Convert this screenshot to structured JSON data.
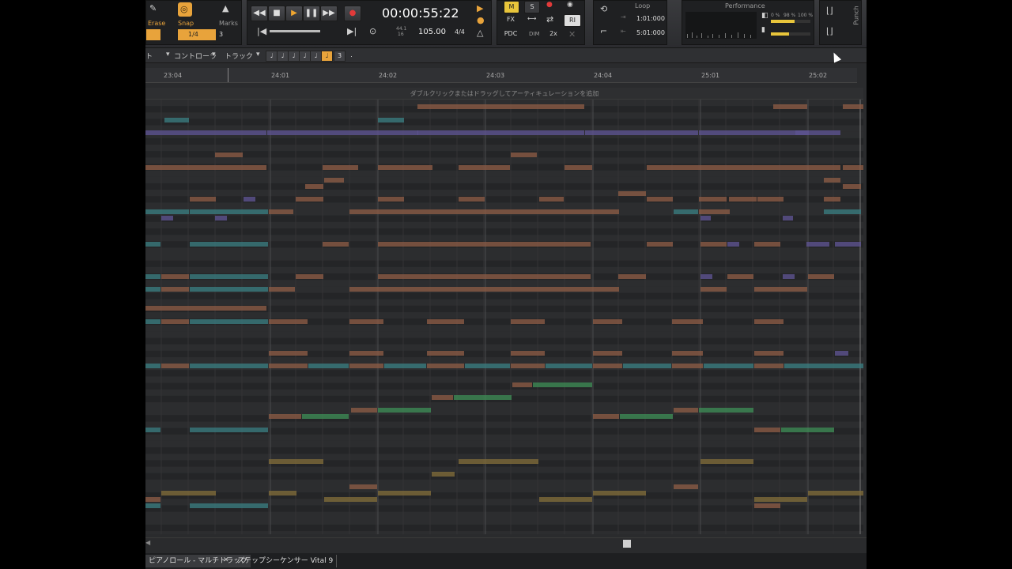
{
  "modules": {
    "tools": {
      "erase": "Erase",
      "snap": "Snap",
      "marks": "Marks",
      "snap_value": "1/4",
      "snap_count": "3"
    },
    "transport": {
      "time": "00:00:55:22",
      "tempo": "105.00",
      "meter": "4/4",
      "sample_rate": "44.1",
      "bit_depth": "16"
    },
    "mix": {
      "m": "M",
      "s": "S",
      "fx": "FX",
      "pdc": "PDC",
      "ri": "RI",
      "x2": "2x"
    },
    "loop": {
      "label": "Loop",
      "start": "1:01:000",
      "end": "5:01:000"
    },
    "performance": {
      "label": "Performance",
      "pct_a": "0 %",
      "pct_b": "98 %",
      "pct_c": "100 %"
    },
    "punch": {
      "label": "Punch"
    }
  },
  "toolbar": {
    "menus": [
      "ト",
      "コントローラ",
      "トラック"
    ],
    "dur_buttons": [
      "♩",
      "♩",
      "♩",
      "♩",
      "♩",
      "♩",
      "3",
      "."
    ]
  },
  "ruler": {
    "labels": [
      "23:04",
      "24:01",
      "24:02",
      "24:03",
      "24:04",
      "25:01",
      "25:02"
    ]
  },
  "artic_hint": "ダブルクリックまたはドラッグしてアーティキュレーションを追加",
  "tabs": [
    "ピアノロール - マルチトラック",
    "ステップシーケンサー Vital 9"
  ],
  "colors": {
    "orange": "#8a5a45",
    "teal": "#3a7a7e",
    "purple": "#5c5290",
    "green": "#3d8a55",
    "gold": "#7e6a3a",
    "accent": "#e8a33b"
  },
  "notes": [
    [
      0,
      344,
      556,
      135
    ],
    [
      0,
      882,
      927,
      135
    ],
    [
      0,
      794,
      838,
      135
    ],
    [
      1,
      24,
      56,
      152
    ],
    [
      1,
      294,
      328,
      152
    ],
    [
      2,
      0,
      154,
      168
    ],
    [
      2,
      154,
      346,
      168
    ],
    [
      2,
      344,
      556,
      168
    ],
    [
      2,
      556,
      700,
      168
    ],
    [
      2,
      700,
      880,
      168
    ],
    [
      2,
      822,
      840,
      168
    ],
    [
      0,
      88,
      124,
      196
    ],
    [
      0,
      462,
      496,
      196
    ],
    [
      0,
      0,
      154,
      212
    ],
    [
      0,
      224,
      270,
      212
    ],
    [
      0,
      294,
      364,
      212
    ],
    [
      0,
      396,
      462,
      212
    ],
    [
      0,
      530,
      566,
      212
    ],
    [
      0,
      634,
      880,
      212
    ],
    [
      0,
      882,
      910,
      212
    ],
    [
      0,
      226,
      252,
      228
    ],
    [
      0,
      202,
      226,
      236
    ],
    [
      0,
      858,
      880,
      228
    ],
    [
      0,
      882,
      906,
      236
    ],
    [
      0,
      56,
      90,
      252
    ],
    [
      0,
      190,
      226,
      252
    ],
    [
      0,
      294,
      328,
      252
    ],
    [
      0,
      396,
      430,
      252
    ],
    [
      0,
      498,
      530,
      252
    ],
    [
      0,
      598,
      634,
      245
    ],
    [
      0,
      634,
      668,
      252
    ],
    [
      0,
      700,
      736,
      252
    ],
    [
      0,
      738,
      774,
      252
    ],
    [
      0,
      774,
      808,
      252
    ],
    [
      0,
      858,
      880,
      252
    ],
    [
      2,
      124,
      140,
      252
    ],
    [
      1,
      0,
      56,
      268
    ],
    [
      1,
      56,
      156,
      268
    ],
    [
      0,
      156,
      188,
      268
    ],
    [
      0,
      258,
      600,
      268
    ],
    [
      1,
      668,
      700,
      268
    ],
    [
      0,
      700,
      740,
      268
    ],
    [
      1,
      858,
      906,
      268
    ],
    [
      2,
      20,
      36,
      276
    ],
    [
      2,
      88,
      104,
      276
    ],
    [
      2,
      702,
      716,
      276
    ],
    [
      2,
      806,
      820,
      276
    ],
    [
      1,
      0,
      20,
      309
    ],
    [
      1,
      56,
      156,
      309
    ],
    [
      0,
      224,
      258,
      309
    ],
    [
      0,
      294,
      564,
      309
    ],
    [
      0,
      634,
      668,
      309
    ],
    [
      0,
      702,
      736,
      309
    ],
    [
      2,
      736,
      752,
      309
    ],
    [
      0,
      770,
      804,
      309
    ],
    [
      2,
      836,
      866,
      309
    ],
    [
      2,
      872,
      906,
      309
    ],
    [
      1,
      0,
      20,
      350
    ],
    [
      0,
      20,
      56,
      350
    ],
    [
      1,
      56,
      156,
      350
    ],
    [
      0,
      190,
      226,
      350
    ],
    [
      0,
      294,
      564,
      350
    ],
    [
      0,
      598,
      634,
      350
    ],
    [
      2,
      702,
      718,
      350
    ],
    [
      0,
      736,
      770,
      350
    ],
    [
      2,
      806,
      822,
      350
    ],
    [
      0,
      838,
      872,
      350
    ],
    [
      1,
      0,
      20,
      366
    ],
    [
      0,
      20,
      56,
      366
    ],
    [
      1,
      56,
      156,
      366
    ],
    [
      0,
      156,
      190,
      366
    ],
    [
      0,
      258,
      600,
      366
    ],
    [
      0,
      702,
      736,
      366
    ],
    [
      0,
      770,
      838,
      366
    ],
    [
      0,
      0,
      154,
      390
    ],
    [
      1,
      0,
      20,
      407
    ],
    [
      0,
      20,
      56,
      407
    ],
    [
      1,
      56,
      156,
      407
    ],
    [
      0,
      156,
      206,
      407
    ],
    [
      0,
      258,
      302,
      407
    ],
    [
      0,
      356,
      404,
      407
    ],
    [
      0,
      462,
      506,
      407
    ],
    [
      0,
      566,
      604,
      407
    ],
    [
      0,
      666,
      706,
      407
    ],
    [
      0,
      770,
      808,
      407
    ],
    [
      0,
      156,
      206,
      447
    ],
    [
      0,
      258,
      302,
      447
    ],
    [
      0,
      356,
      404,
      447
    ],
    [
      0,
      462,
      506,
      447
    ],
    [
      0,
      566,
      604,
      447
    ],
    [
      0,
      666,
      706,
      447
    ],
    [
      0,
      770,
      808,
      447
    ],
    [
      2,
      872,
      890,
      447
    ],
    [
      1,
      0,
      20,
      463
    ],
    [
      0,
      20,
      56,
      463
    ],
    [
      1,
      56,
      156,
      463
    ],
    [
      0,
      156,
      206,
      463
    ],
    [
      1,
      206,
      258,
      463
    ],
    [
      0,
      258,
      302,
      463
    ],
    [
      1,
      302,
      356,
      463
    ],
    [
      0,
      356,
      404,
      463
    ],
    [
      1,
      404,
      462,
      463
    ],
    [
      0,
      462,
      506,
      463
    ],
    [
      1,
      506,
      566,
      463
    ],
    [
      0,
      566,
      604,
      463
    ],
    [
      1,
      604,
      666,
      463
    ],
    [
      0,
      666,
      706,
      463
    ],
    [
      1,
      706,
      770,
      463
    ],
    [
      0,
      770,
      808,
      463
    ],
    [
      1,
      808,
      910,
      463
    ],
    [
      0,
      464,
      490,
      487
    ],
    [
      3,
      490,
      566,
      487
    ],
    [
      0,
      362,
      390,
      503
    ],
    [
      3,
      390,
      464,
      503
    ],
    [
      0,
      260,
      294,
      519
    ],
    [
      3,
      294,
      362,
      519
    ],
    [
      0,
      668,
      700,
      519
    ],
    [
      3,
      700,
      770,
      519
    ],
    [
      0,
      156,
      198,
      527
    ],
    [
      3,
      198,
      258,
      527
    ],
    [
      0,
      566,
      600,
      527
    ],
    [
      3,
      600,
      668,
      527
    ],
    [
      1,
      0,
      20,
      544
    ],
    [
      1,
      56,
      156,
      544
    ],
    [
      0,
      770,
      804,
      544
    ],
    [
      3,
      804,
      872,
      544
    ],
    [
      4,
      156,
      226,
      584
    ],
    [
      4,
      396,
      498,
      584
    ],
    [
      4,
      702,
      770,
      584
    ],
    [
      4,
      362,
      392,
      600
    ],
    [
      0,
      258,
      294,
      616
    ],
    [
      0,
      668,
      700,
      616
    ],
    [
      4,
      20,
      90,
      624
    ],
    [
      4,
      156,
      192,
      624
    ],
    [
      4,
      294,
      362,
      624
    ],
    [
      4,
      566,
      634,
      624
    ],
    [
      4,
      838,
      910,
      624
    ],
    [
      0,
      0,
      20,
      632
    ],
    [
      4,
      226,
      294,
      632
    ],
    [
      4,
      498,
      566,
      632
    ],
    [
      4,
      770,
      838,
      632
    ],
    [
      1,
      0,
      20,
      640
    ],
    [
      1,
      56,
      156,
      640
    ],
    [
      0,
      770,
      804,
      640
    ]
  ]
}
